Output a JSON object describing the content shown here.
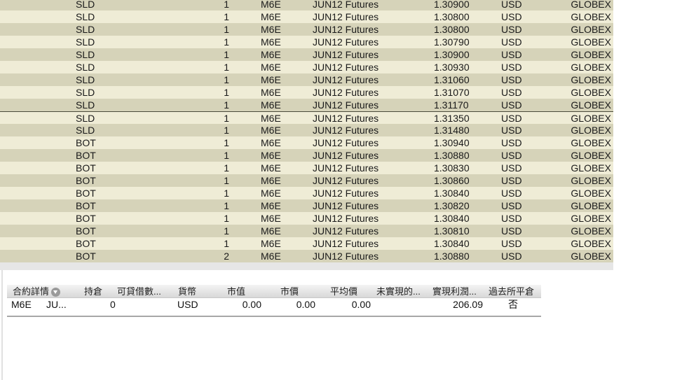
{
  "trades": [
    {
      "side": "SLD",
      "qty": "1",
      "symbol": "M6E",
      "expiry": "JUN12 Futures",
      "price": "1.30900",
      "currency": "USD",
      "exchange": "GLOBEX"
    },
    {
      "side": "SLD",
      "qty": "1",
      "symbol": "M6E",
      "expiry": "JUN12 Futures",
      "price": "1.30800",
      "currency": "USD",
      "exchange": "GLOBEX"
    },
    {
      "side": "SLD",
      "qty": "1",
      "symbol": "M6E",
      "expiry": "JUN12 Futures",
      "price": "1.30800",
      "currency": "USD",
      "exchange": "GLOBEX"
    },
    {
      "side": "SLD",
      "qty": "1",
      "symbol": "M6E",
      "expiry": "JUN12 Futures",
      "price": "1.30790",
      "currency": "USD",
      "exchange": "GLOBEX"
    },
    {
      "side": "SLD",
      "qty": "1",
      "symbol": "M6E",
      "expiry": "JUN12 Futures",
      "price": "1.30900",
      "currency": "USD",
      "exchange": "GLOBEX"
    },
    {
      "side": "SLD",
      "qty": "1",
      "symbol": "M6E",
      "expiry": "JUN12 Futures",
      "price": "1.30930",
      "currency": "USD",
      "exchange": "GLOBEX"
    },
    {
      "side": "SLD",
      "qty": "1",
      "symbol": "M6E",
      "expiry": "JUN12 Futures",
      "price": "1.31060",
      "currency": "USD",
      "exchange": "GLOBEX"
    },
    {
      "side": "SLD",
      "qty": "1",
      "symbol": "M6E",
      "expiry": "JUN12 Futures",
      "price": "1.31070",
      "currency": "USD",
      "exchange": "GLOBEX"
    },
    {
      "side": "SLD",
      "qty": "1",
      "symbol": "M6E",
      "expiry": "JUN12 Futures",
      "price": "1.31170",
      "currency": "USD",
      "exchange": "GLOBEX"
    },
    {
      "side": "SLD",
      "qty": "1",
      "symbol": "M6E",
      "expiry": "JUN12 Futures",
      "price": "1.31350",
      "currency": "USD",
      "exchange": "GLOBEX",
      "selected": true
    },
    {
      "side": "SLD",
      "qty": "1",
      "symbol": "M6E",
      "expiry": "JUN12 Futures",
      "price": "1.31480",
      "currency": "USD",
      "exchange": "GLOBEX"
    },
    {
      "side": "BOT",
      "qty": "1",
      "symbol": "M6E",
      "expiry": "JUN12 Futures",
      "price": "1.30940",
      "currency": "USD",
      "exchange": "GLOBEX"
    },
    {
      "side": "BOT",
      "qty": "1",
      "symbol": "M6E",
      "expiry": "JUN12 Futures",
      "price": "1.30880",
      "currency": "USD",
      "exchange": "GLOBEX"
    },
    {
      "side": "BOT",
      "qty": "1",
      "symbol": "M6E",
      "expiry": "JUN12 Futures",
      "price": "1.30830",
      "currency": "USD",
      "exchange": "GLOBEX"
    },
    {
      "side": "BOT",
      "qty": "1",
      "symbol": "M6E",
      "expiry": "JUN12 Futures",
      "price": "1.30860",
      "currency": "USD",
      "exchange": "GLOBEX"
    },
    {
      "side": "BOT",
      "qty": "1",
      "symbol": "M6E",
      "expiry": "JUN12 Futures",
      "price": "1.30840",
      "currency": "USD",
      "exchange": "GLOBEX"
    },
    {
      "side": "BOT",
      "qty": "1",
      "symbol": "M6E",
      "expiry": "JUN12 Futures",
      "price": "1.30820",
      "currency": "USD",
      "exchange": "GLOBEX"
    },
    {
      "side": "BOT",
      "qty": "1",
      "symbol": "M6E",
      "expiry": "JUN12 Futures",
      "price": "1.30840",
      "currency": "USD",
      "exchange": "GLOBEX"
    },
    {
      "side": "BOT",
      "qty": "1",
      "symbol": "M6E",
      "expiry": "JUN12 Futures",
      "price": "1.30810",
      "currency": "USD",
      "exchange": "GLOBEX"
    },
    {
      "side": "BOT",
      "qty": "1",
      "symbol": "M6E",
      "expiry": "JUN12 Futures",
      "price": "1.30840",
      "currency": "USD",
      "exchange": "GLOBEX"
    },
    {
      "side": "BOT",
      "qty": "2",
      "symbol": "M6E",
      "expiry": "JUN12 Futures",
      "price": "1.30880",
      "currency": "USD",
      "exchange": "GLOBEX"
    }
  ],
  "portfolio": {
    "headers": {
      "contract": "合約詳情",
      "position": "持倉",
      "borrowable": "可貸借數...",
      "currency": "貨幣",
      "market_value": "市值",
      "market_price": "市價",
      "avg_price": "平均價",
      "unrealized": "未實現的...",
      "realized": "實現利潤...",
      "closed": "過去所平倉"
    },
    "header_icon": "dropdown-circle-icon",
    "row": {
      "symbol": "M6E",
      "expiry": "JU...",
      "position": "0",
      "currency": "USD",
      "market_value": "0.00",
      "market_price": "0.00",
      "avg_price": "0.00",
      "realized": "206.09",
      "closed": "否"
    }
  },
  "colors": {
    "row_odd": "#d6d3b9",
    "row_even": "#efecd6"
  }
}
